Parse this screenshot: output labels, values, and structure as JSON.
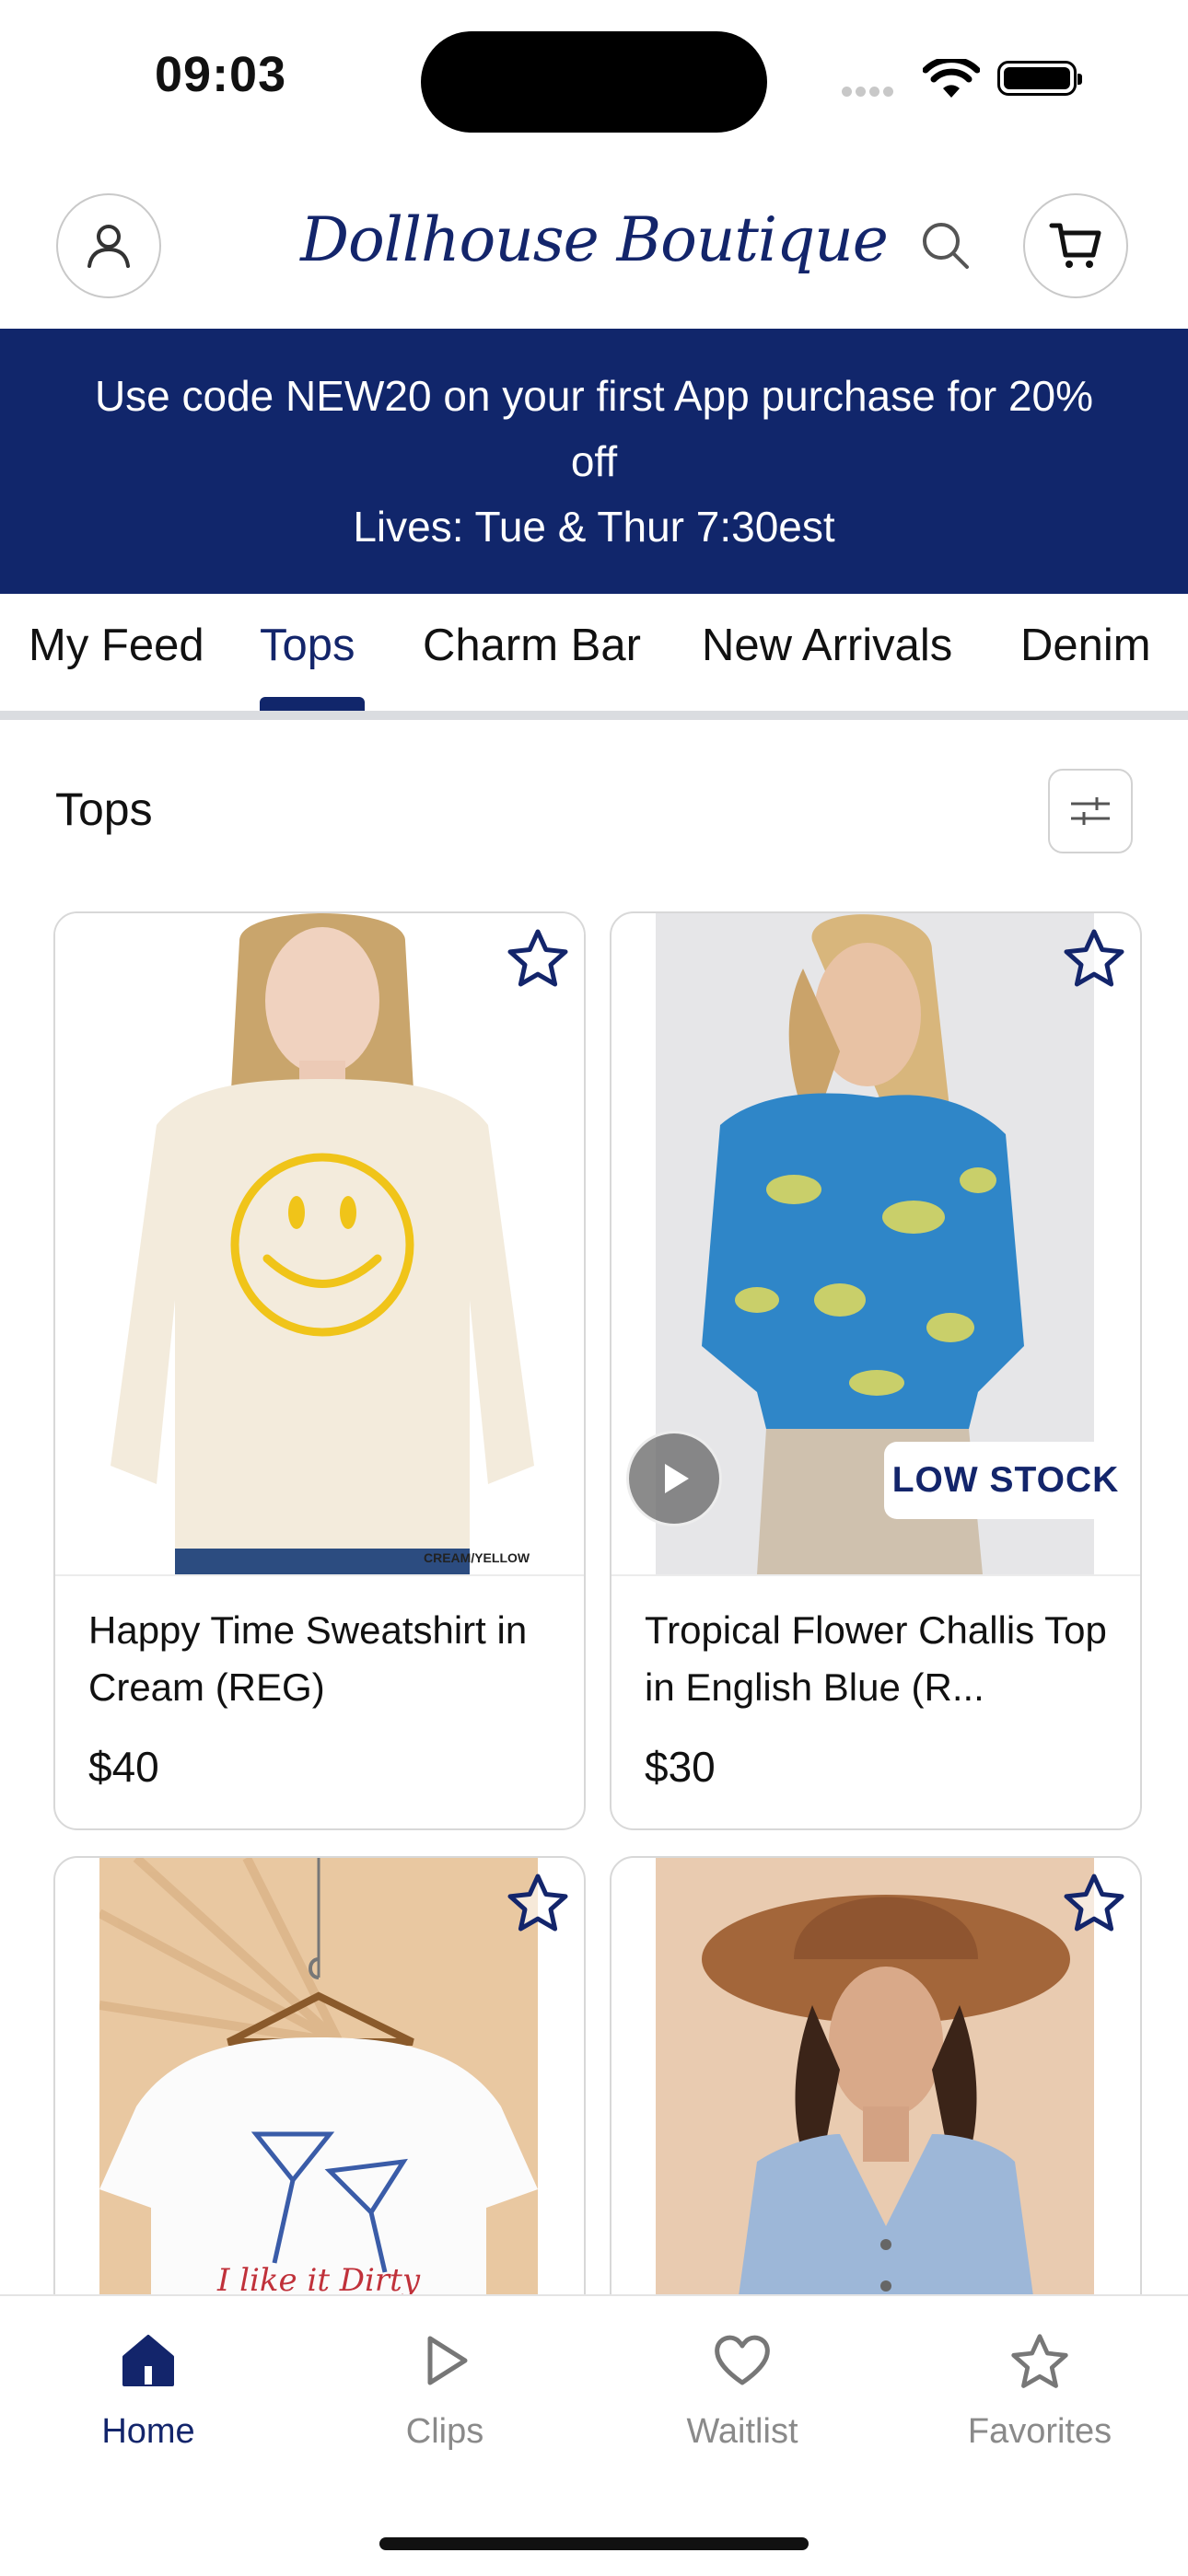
{
  "status_bar": {
    "time": "09:03"
  },
  "header": {
    "logo_text": "Dollhouse Boutique",
    "icons": [
      "account-icon",
      "search-icon",
      "cart-icon"
    ]
  },
  "banner": {
    "line1": "Use code NEW20 on your first App purchase for 20%",
    "line2": "off",
    "line3": "Lives: Tue & Thur 7:30est",
    "background": "#11266b"
  },
  "tabs": [
    {
      "label": "My Feed",
      "active": false
    },
    {
      "label": "Tops",
      "active": true
    },
    {
      "label": "Charm Bar",
      "active": false
    },
    {
      "label": "New Arrivals",
      "active": false
    },
    {
      "label": "Denim",
      "active": false
    }
  ],
  "section": {
    "title": "Tops"
  },
  "products": [
    {
      "name": "Happy Time Sweatshirt in Cream (REG)",
      "price": "$40",
      "badge": "",
      "image_caption": "CREAM/YELLOW",
      "image": "model in cream sweatshirt with yellow smiley"
    },
    {
      "name": "Tropical Flower Challis Top in English Blue (R...",
      "price": "$30",
      "badge": "LOW STOCK",
      "image": "model in blue floral top"
    },
    {
      "name": "",
      "price": "",
      "badge": "",
      "image_script_text": "I like it Dirty",
      "image": "white tee with martini glasses on hanger"
    },
    {
      "name": "",
      "price": "",
      "badge": "",
      "image": "model in denim vest and brown hat"
    }
  ],
  "bottom_nav": [
    {
      "label": "Home",
      "icon": "home-icon",
      "active": true
    },
    {
      "label": "Clips",
      "icon": "play-icon",
      "active": false
    },
    {
      "label": "Waitlist",
      "icon": "heart-icon",
      "active": false
    },
    {
      "label": "Favorites",
      "icon": "star-icon",
      "active": false
    }
  ],
  "colors": {
    "brand": "#13256b",
    "inactive": "#8a8a8a",
    "border": "#d8d8d8"
  }
}
